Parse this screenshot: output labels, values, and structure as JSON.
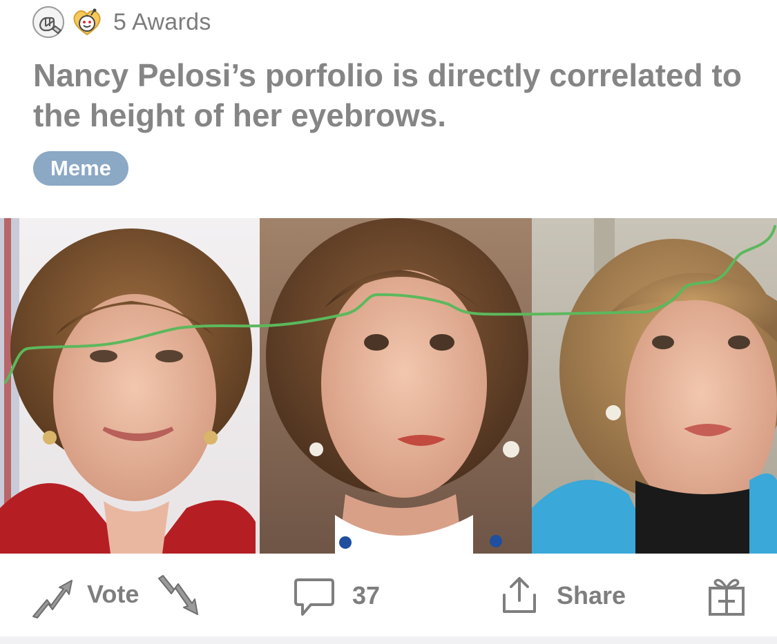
{
  "post": {
    "awards": {
      "icons": [
        "fist-bump-award-icon",
        "wholesome-heart-award-icon"
      ],
      "label": "5 Awards"
    },
    "title": "Nancy Pelosi’s porfolio is directly correlated to the height of her eyebrows.",
    "flair": "Meme",
    "image": {
      "description_icons": [
        "portrait-panel-1",
        "portrait-panel-2",
        "portrait-panel-3"
      ],
      "line_color": "#5cb85c"
    }
  },
  "actions": {
    "vote_label": "Vote",
    "comment_count": "37",
    "share_label": "Share",
    "icons": [
      "upvote-icon",
      "downvote-icon",
      "comment-icon",
      "share-icon",
      "gift-icon"
    ]
  },
  "colors": {
    "flair_bg": "#8ba8c5",
    "text_gray": "#7e7e7e",
    "chart_line": "#5cb85c"
  }
}
